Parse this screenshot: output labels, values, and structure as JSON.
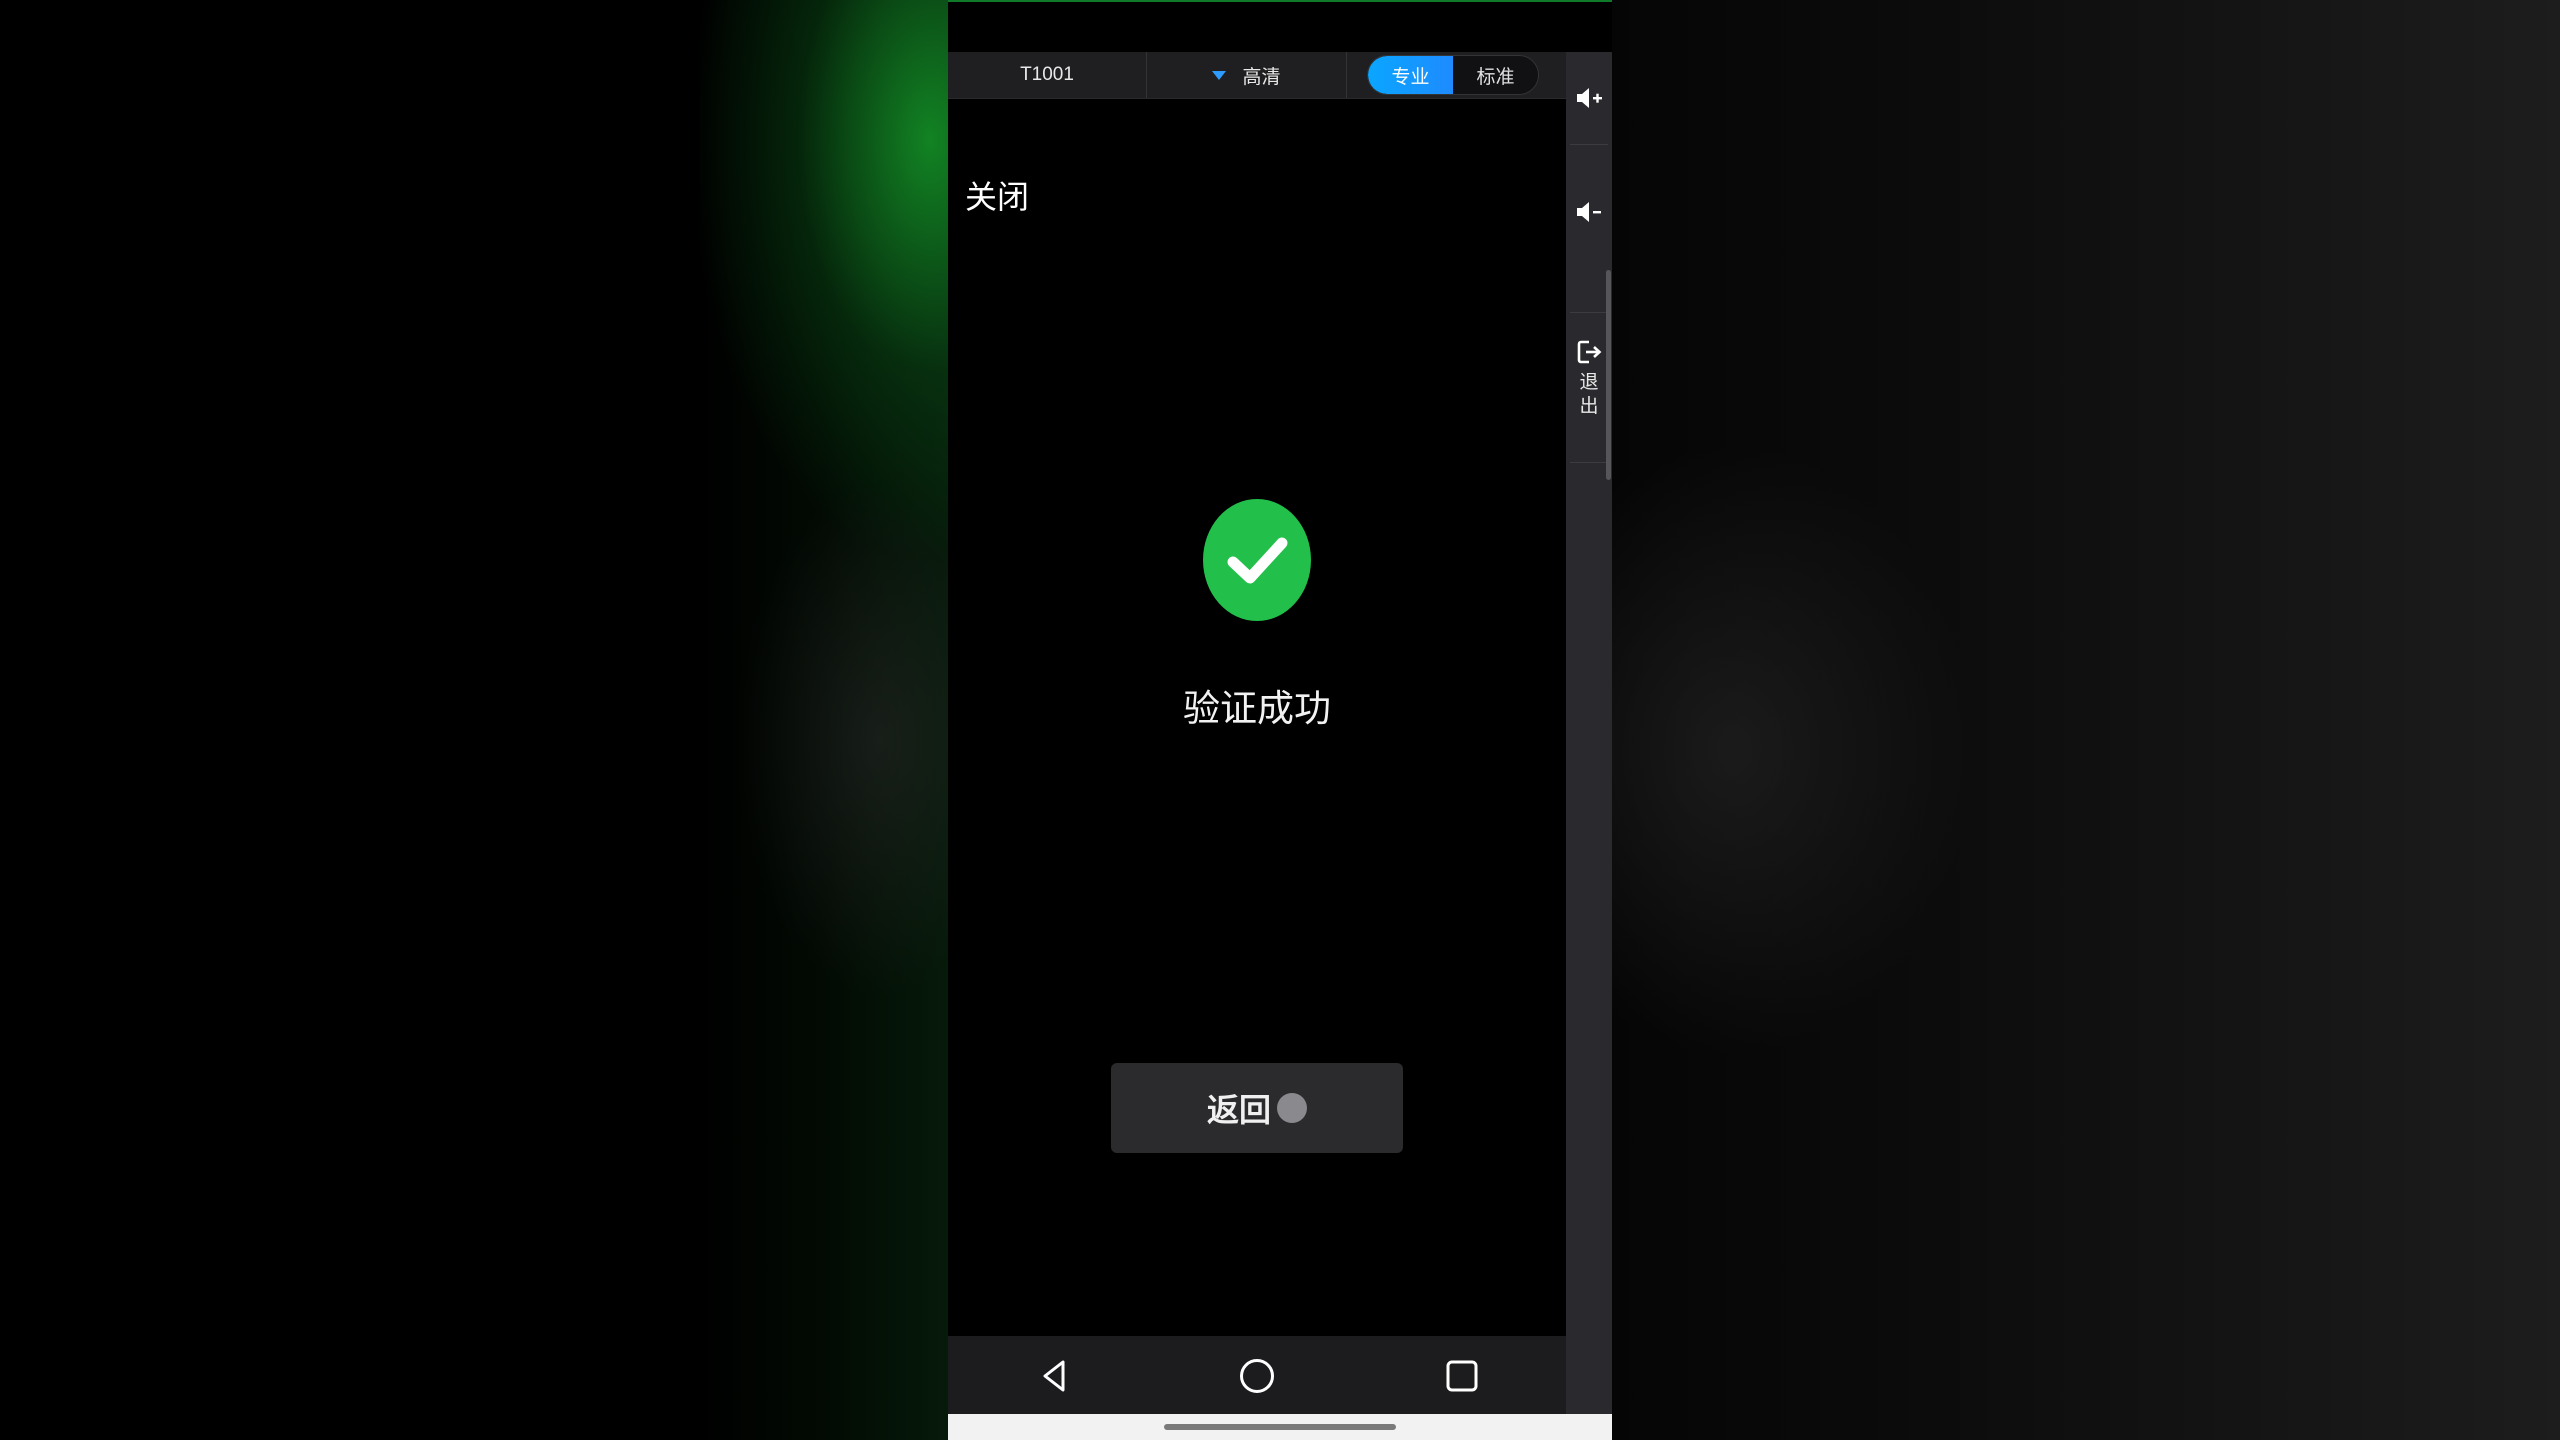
{
  "topbar": {
    "room_id": "T1001",
    "quality_label": "高清",
    "mode_options": [
      "专业",
      "标准"
    ],
    "active_mode": "专业"
  },
  "rail": {
    "volume_up_icon": "volume-up-icon",
    "volume_down_icon": "volume-down-icon",
    "exit_icon": "exit-icon",
    "exit_label_line1": "退",
    "exit_label_line2": "出"
  },
  "content": {
    "close_label": "关闭",
    "status_icon": "check-circle-icon",
    "status_text": "验证成功",
    "back_button_label": "返回"
  },
  "navbar": {
    "back_icon": "triangle-back-icon",
    "home_icon": "circle-home-icon",
    "recents_icon": "square-recents-icon"
  },
  "colors": {
    "accent_blue": "#1e8bff",
    "success_green": "#22c04a",
    "background": "#000000"
  }
}
